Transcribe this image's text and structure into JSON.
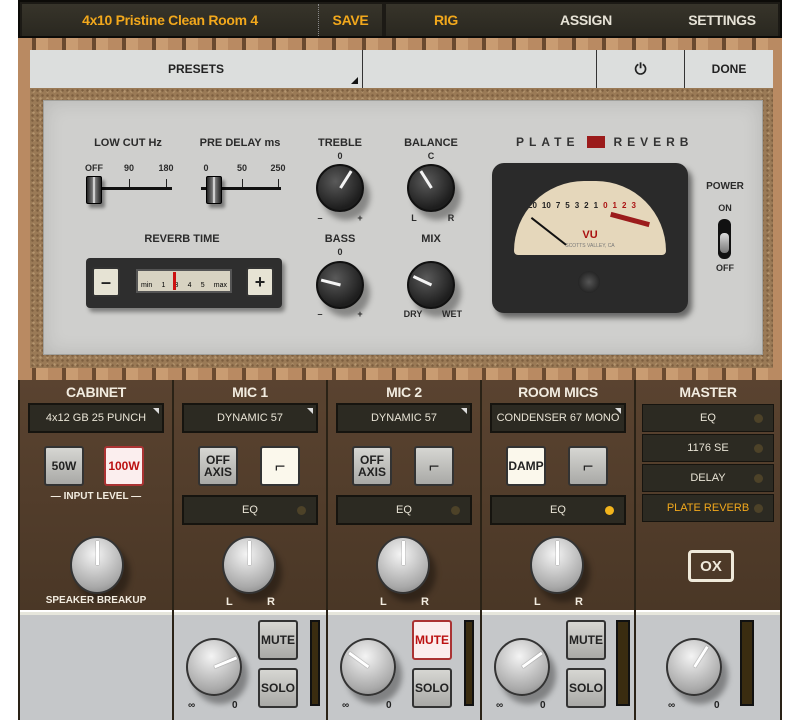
{
  "topbar": {
    "preset_name": "4x10 Pristine Clean Room 4",
    "save": "SAVE",
    "tabs": [
      "RIG",
      "ASSIGN",
      "SETTINGS"
    ],
    "active_tab": "RIG",
    "accent": "#f2a81c"
  },
  "preset_bar": {
    "presets": "PRESETS",
    "done": "DONE",
    "power_icon": "power-icon"
  },
  "plate": {
    "brand_left": "PLATE",
    "brand_right": "REVERB",
    "low_cut": {
      "label": "LOW CUT Hz",
      "ticks": [
        "OFF",
        "90",
        "180"
      ],
      "value": "OFF"
    },
    "pre_delay": {
      "label": "PRE DELAY ms",
      "ticks": [
        "0",
        "50",
        "250"
      ],
      "value": 0.1
    },
    "treble": {
      "label": "TREBLE",
      "top": "0",
      "min": "–",
      "max": "+",
      "value": 0.62
    },
    "balance": {
      "label": "BALANCE",
      "top": "C",
      "min": "L",
      "max": "R",
      "value": 0.38
    },
    "bass": {
      "label": "BASS",
      "top": "0",
      "min": "–",
      "max": "+",
      "value": 0.22
    },
    "mix": {
      "label": "MIX",
      "min": "DRY",
      "max": "WET",
      "value": 0.26
    },
    "reverb_time": {
      "label": "REVERB TIME",
      "minus": "–",
      "plus": "+",
      "scale": [
        "min",
        "1",
        "3",
        "4",
        "5",
        "max"
      ],
      "value": 0.4
    },
    "vu": {
      "label": "VU",
      "scale_top": [
        "20",
        "10",
        "7",
        "5",
        "3",
        "2",
        "1",
        "0",
        "1",
        "2",
        "3"
      ],
      "caption": "SCOTTS VALLEY, CA"
    },
    "power": {
      "label": "POWER",
      "on": "ON",
      "off": "OFF",
      "state": "ON"
    }
  },
  "channels": {
    "cabinet": {
      "title": "CABINET",
      "model": "4x12 GB 25 PUNCH",
      "btn_50w": "50W",
      "btn_100w": "100W",
      "selected": "100W",
      "input_level": "INPUT LEVEL",
      "knob_label": "SPEAKER BREAKUP",
      "knob": 0.5
    },
    "mic1": {
      "title": "MIC 1",
      "model": "DYNAMIC 57",
      "off_axis": "OFF AXIS",
      "eq": "EQ",
      "eq_on": false,
      "pan": 0.5,
      "l": "L",
      "r": "R",
      "mute": "MUTE",
      "solo": "SOLO",
      "muted": false,
      "volume": 0.75,
      "vmin": "∞",
      "vmax": "0"
    },
    "mic2": {
      "title": "MIC 2",
      "model": "DYNAMIC 57",
      "off_axis": "OFF AXIS",
      "eq": "EQ",
      "eq_on": false,
      "pan": 0.5,
      "l": "L",
      "r": "R",
      "mute": "MUTE",
      "solo": "SOLO",
      "muted": true,
      "volume": 0.3,
      "vmin": "∞",
      "vmax": "0"
    },
    "room": {
      "title": "ROOM MICS",
      "model": "CONDENSER 67 MONO",
      "damp": "DAMP",
      "eq": "EQ",
      "eq_on": true,
      "pan": 0.5,
      "l": "L",
      "r": "R",
      "mute": "MUTE",
      "solo": "SOLO",
      "muted": false,
      "volume": 0.7,
      "vmin": "∞",
      "vmax": "0"
    },
    "master": {
      "title": "MASTER",
      "fx": [
        "EQ",
        "1176 SE",
        "DELAY",
        "PLATE REVERB"
      ],
      "active_fx": "PLATE REVERB",
      "ox": "OX",
      "volume": 0.62,
      "vmin": "∞",
      "vmax": "0"
    }
  }
}
